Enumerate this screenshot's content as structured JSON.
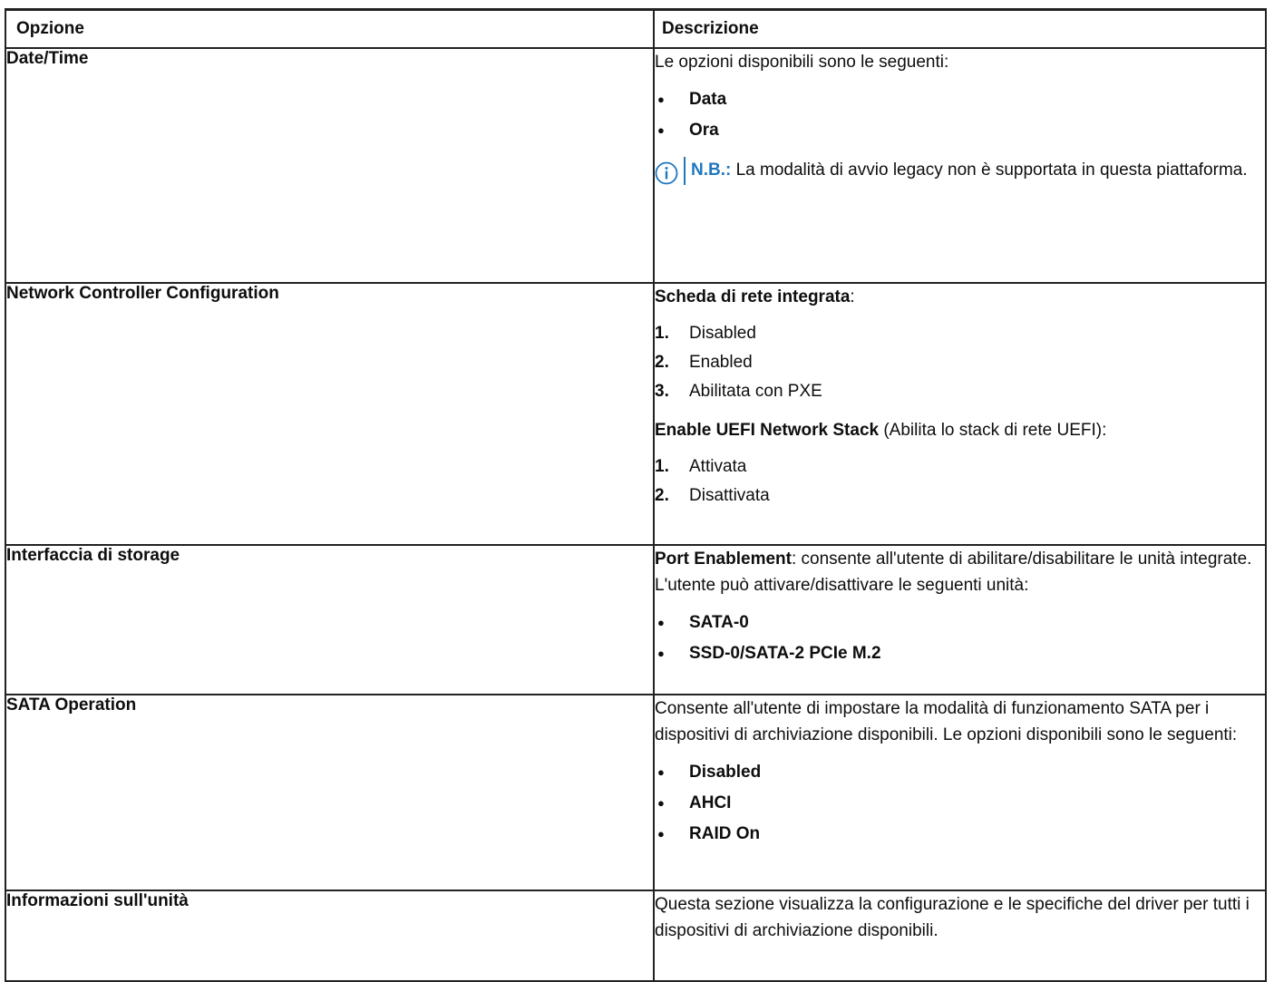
{
  "header": {
    "col1": "Opzione",
    "col2": "Descrizione"
  },
  "rows": [
    {
      "option": "Date/Time",
      "intro": "Le opzioni disponibili sono le seguenti:",
      "bullets": [
        "Data",
        "Ora"
      ],
      "note_label": "N.B.:",
      "note_text": " La modalità di avvio legacy non è supportata in questa piattaforma."
    },
    {
      "option": "Network Controller Configuration",
      "heading1_bold": "Scheda di rete integrata",
      "heading1_rest": ":",
      "list1": [
        "Disabled",
        "Enabled",
        "Abilitata con PXE"
      ],
      "heading2_bold": "Enable UEFI Network Stack",
      "heading2_rest": " (Abilita lo stack di rete UEFI):",
      "list2": [
        "Attivata",
        "Disattivata"
      ]
    },
    {
      "option": "Interfaccia di storage",
      "intro_bold": "Port Enablement",
      "intro_rest": ": consente all'utente di abilitare/disabilitare le unità integrate. L'utente può attivare/disattivare le seguenti unità:",
      "bullets": [
        "SATA-0",
        "SSD-0/SATA-2 PCIe M.2"
      ]
    },
    {
      "option": "SATA Operation",
      "intro": "Consente all'utente di impostare la modalità di funzionamento SATA per i dispositivi di archiviazione disponibili. Le opzioni disponibili sono le seguenti:",
      "bullets": [
        "Disabled",
        "AHCI",
        "RAID On"
      ]
    },
    {
      "option": "Informazioni sull'unità",
      "intro": "Questa sezione visualizza la configurazione e le specifiche del driver per tutti i dispositivi di archiviazione disponibili."
    }
  ],
  "numbers": [
    "1.",
    "2.",
    "3."
  ],
  "colors": {
    "note_accent": "#1f77c0",
    "border": "#222222"
  },
  "icons": {
    "note": "info-circle-icon"
  }
}
